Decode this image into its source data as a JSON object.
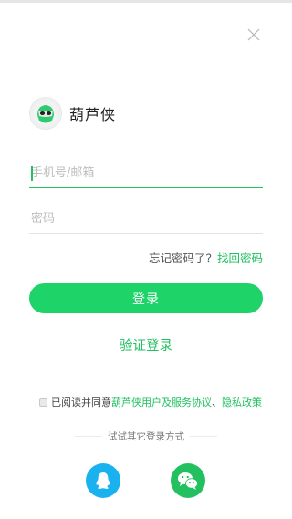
{
  "app": {
    "name": "葫芦侠"
  },
  "form": {
    "phone_placeholder": "手机号/邮箱",
    "password_placeholder": "密码"
  },
  "forgot": {
    "question": "忘记密码了？",
    "link": "找回密码"
  },
  "buttons": {
    "login": "登录",
    "verify_login": "验证登录"
  },
  "agreement": {
    "checked": false,
    "prefix": "已阅读并同意",
    "terms": "葫芦侠用户及服务协议",
    "separator": "、",
    "privacy": "隐私政策"
  },
  "other_login": {
    "label": "试试其它登录方式",
    "providers": [
      "qq-icon",
      "wechat-icon"
    ]
  },
  "colors": {
    "accent": "#21c15f",
    "button": "#1ed367",
    "qq": "#1ab1ef",
    "wechat": "#22c05e"
  }
}
